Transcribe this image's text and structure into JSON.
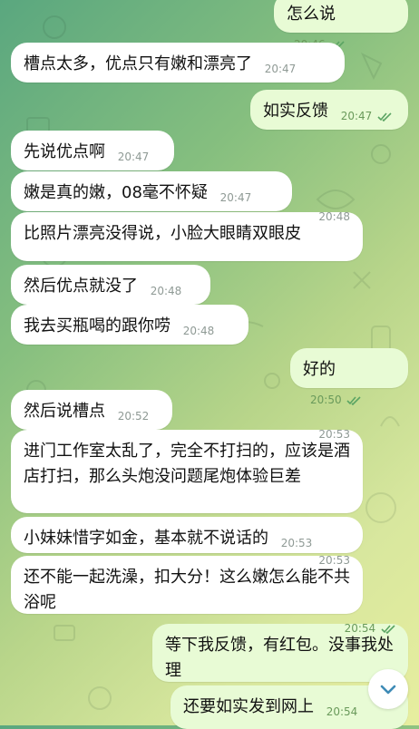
{
  "messages": [
    {
      "dir": "out",
      "text": "怎么说",
      "time": "20:46",
      "read": true
    },
    {
      "dir": "in",
      "text": "槽点太多，优点只有嫩和漂亮了",
      "time": "20:47"
    },
    {
      "dir": "out",
      "text": "如实反馈",
      "time": "20:47",
      "read": true
    },
    {
      "dir": "in",
      "text": "先说优点啊",
      "time": "20:47"
    },
    {
      "dir": "in",
      "text": "嫩是真的嫩，08毫不怀疑",
      "time": "20:47"
    },
    {
      "dir": "in",
      "text": "比照片漂亮没得说，小脸大眼睛双眼皮",
      "time": "20:48"
    },
    {
      "dir": "in",
      "text": "然后优点就没了",
      "time": "20:48"
    },
    {
      "dir": "in",
      "text": "我去买瓶喝的跟你唠",
      "time": "20:48"
    },
    {
      "dir": "out",
      "text": "好的",
      "time": "20:50",
      "read": true
    },
    {
      "dir": "in",
      "text": "然后说槽点",
      "time": "20:52"
    },
    {
      "dir": "in",
      "text": "进门工作室太乱了，完全不打扫的，应该是酒店打扫，那么头炮没问题尾炮体验巨差",
      "time": "20:53"
    },
    {
      "dir": "in",
      "text": "小妹妹惜字如金，基本就不说话的",
      "time": "20:53"
    },
    {
      "dir": "in",
      "text": "还不能一起洗澡，扣大分！这么嫩怎么能不共浴呢",
      "time": "20:53"
    },
    {
      "dir": "out",
      "text": "等下我反馈，有红包。没事我处理",
      "time": "20:54",
      "read": true
    },
    {
      "dir": "out",
      "text": "还要如实发到网上",
      "time": "20:54",
      "read": false
    }
  ],
  "colors": {
    "incoming": "#ffffff",
    "outgoing": "#e8fbd5",
    "check": "#5aa463",
    "time": "#8f9a95"
  },
  "icons": {
    "read": "double-check-icon",
    "scroll": "chevron-down-icon"
  }
}
